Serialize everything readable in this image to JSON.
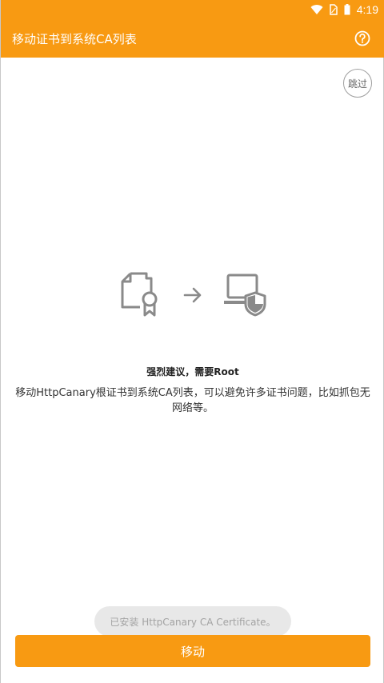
{
  "status_bar": {
    "time": "4:19",
    "icons": [
      "wifi-icon",
      "sim-icon",
      "battery-icon"
    ]
  },
  "app_bar": {
    "title": "移动证书到系统CA列表",
    "help_icon": "help-icon"
  },
  "skip_button": {
    "label": "跳过"
  },
  "illustration": {
    "icons": [
      "certificate-icon",
      "arrow-right-icon",
      "secure-laptop-icon"
    ]
  },
  "hint": {
    "title": "强烈建议，需要Root",
    "description": "移动HttpCanary根证书到系统CA列表，可以避免许多证书问题，比如抓包无网络等。"
  },
  "toast": {
    "text": "已安装 HttpCanary CA Certificate。"
  },
  "primary_button": {
    "label": "移动"
  },
  "colors": {
    "accent": "#f89a12",
    "icon_gray": "#8a8a8a"
  }
}
